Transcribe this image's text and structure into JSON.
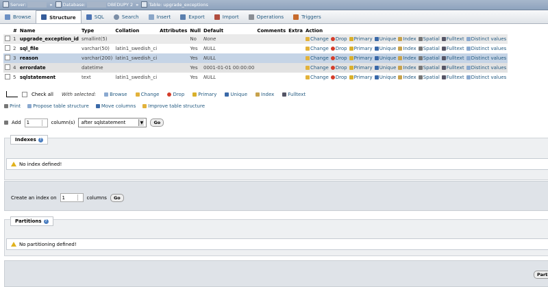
{
  "breadcrumb": {
    "server_label": "Server:",
    "database_label": "Database:",
    "database_name": "DBEDUPY 2",
    "table_label": "Table:",
    "table_name": "upgrade_exceptions"
  },
  "tabs": [
    {
      "label": "Browse",
      "icon": "table-icon",
      "color": "#6c90c4"
    },
    {
      "label": "Structure",
      "icon": "structure-icon",
      "color": "#355c9a"
    },
    {
      "label": "SQL",
      "icon": "sql-icon",
      "color": "#4b73b3"
    },
    {
      "label": "Search",
      "icon": "search-icon",
      "color": "#7b8ea6"
    },
    {
      "label": "Insert",
      "icon": "insert-icon",
      "color": "#8aa6c8"
    },
    {
      "label": "Export",
      "icon": "export-icon",
      "color": "#5a7fae"
    },
    {
      "label": "Import",
      "icon": "import-icon",
      "color": "#b14d3f"
    },
    {
      "label": "Operations",
      "icon": "wrench-icon",
      "color": "#8b8f95"
    },
    {
      "label": "Triggers",
      "icon": "trigger-icon",
      "color": "#c76b2d"
    }
  ],
  "active_tab": "Structure",
  "table": {
    "headers": {
      "num": "#",
      "name": "Name",
      "type": "Type",
      "collation": "Collation",
      "attributes": "Attributes",
      "null": "Null",
      "default": "Default",
      "comments": "Comments",
      "extra": "Extra",
      "action": "Action"
    },
    "rows": [
      {
        "num": "1",
        "name": "upgrade_exception_id",
        "type": "smallint(5)",
        "collation": "",
        "null": "No",
        "default": "None",
        "row_style": "odd"
      },
      {
        "num": "2",
        "name": "sql_file",
        "type": "varchar(50)",
        "collation": "latin1_swedish_ci",
        "null": "Yes",
        "default": "NULL",
        "row_style": "even"
      },
      {
        "num": "3",
        "name": "reason",
        "type": "varchar(200)",
        "collation": "latin1_swedish_ci",
        "null": "Yes",
        "default": "NULL",
        "row_style": "sel"
      },
      {
        "num": "4",
        "name": "errordate",
        "type": "datetime",
        "collation": "",
        "null": "Yes",
        "default": "0001-01-01 00:00:00",
        "row_style": "dark"
      },
      {
        "num": "5",
        "name": "sqlstatement",
        "type": "text",
        "collation": "latin1_swedish_ci",
        "null": "Yes",
        "default": "NULL",
        "row_style": "even"
      }
    ],
    "action_labels": [
      "Change",
      "Drop",
      "Primary",
      "Unique",
      "Index",
      "Spatial",
      "Fulltext",
      "Distinct values"
    ]
  },
  "with_selected": {
    "check_all": "Check all",
    "label": "With selected:",
    "actions": [
      "Browse",
      "Change",
      "Drop",
      "Primary",
      "Unique",
      "Index",
      "Fulltext"
    ]
  },
  "links": [
    "Print",
    "Propose table structure",
    "Move columns",
    "Improve table structure"
  ],
  "add_columns": {
    "label": "Add",
    "value": "1",
    "unit": "column(s)",
    "position": "after sqlstatement",
    "go": "Go"
  },
  "indexes": {
    "title": "Indexes",
    "notice": "No index defined!",
    "create_label": "Create an index on",
    "create_value": "1",
    "create_unit": "columns",
    "go": "Go"
  },
  "partitions": {
    "title": "Partitions",
    "notice": "No partitioning defined!",
    "button": "Parti"
  }
}
